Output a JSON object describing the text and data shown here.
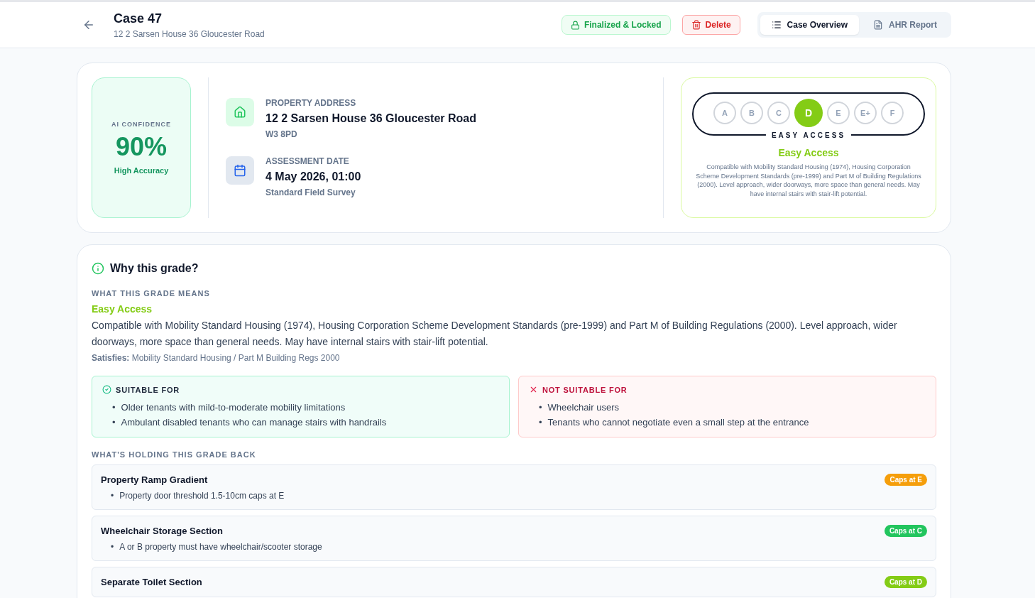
{
  "header": {
    "title": "Case 47",
    "subtitle": "12 2 Sarsen House 36 Gloucester Road",
    "status_badge": "Finalized & Locked",
    "delete_button": "Delete",
    "tabs": [
      {
        "label": "Case Overview",
        "selected": true,
        "kind": "list"
      },
      {
        "label": "AHR Report",
        "selected": false,
        "kind": "doc"
      }
    ]
  },
  "confidence": {
    "label": "AI CONFIDENCE",
    "value": "90%",
    "note": "High Accuracy"
  },
  "details": [
    {
      "kind": "home",
      "label": "PROPERTY ADDRESS",
      "value": "12 2 Sarsen House 36 Gloucester Road",
      "sub": "W3 8PD"
    },
    {
      "kind": "calendar",
      "label": "ASSESSMENT DATE",
      "value": "4 May 2026, 01:00",
      "sub": "Standard Field Survey"
    }
  ],
  "grade": {
    "scale": [
      {
        "label": "A",
        "selected": false
      },
      {
        "label": "B",
        "selected": false
      },
      {
        "label": "C",
        "selected": false
      },
      {
        "label": "D",
        "selected": true
      },
      {
        "label": "E",
        "selected": false
      },
      {
        "label": "E+",
        "selected": false
      },
      {
        "label": "F",
        "selected": false
      }
    ],
    "scale_caption": "EASY ACCESS",
    "title": "Easy Access",
    "description": "Compatible with Mobility Standard Housing (1974), Housing Corporation Scheme Development Standards (pre-1999) and Part M of Building Regulations (2000). Level approach, wider doorways, more space than general needs. May have internal stairs with stair-lift potential.",
    "color": "#84cc16"
  },
  "why": {
    "title": "Why this grade?",
    "means_heading": "WHAT THIS GRADE MEANS",
    "grade_name": "Easy Access",
    "explanation": "Compatible with Mobility Standard Housing (1974), Housing Corporation Scheme Development Standards (pre-1999) and Part M of Building Regulations (2000). Level approach, wider doorways, more space than general needs. May have internal stairs with stair-lift potential.",
    "satisfies": "**Satisfies:** Mobility Standard Housing / Part M Building Regs 2000",
    "suitability": [
      {
        "kind": "suitable",
        "heading": "SUITABLE FOR",
        "items": [
          "Older tenants with mild-to-moderate mobility limitations",
          "Ambulant disabled tenants who can manage stairs with handrails"
        ]
      },
      {
        "kind": "unsuitable",
        "heading": "NOT SUITABLE FOR",
        "items": [
          "Wheelchair users",
          "Tenants who cannot negotiate even a small step at the entrance"
        ]
      }
    ],
    "holding_heading": "WHAT'S HOLDING THIS GRADE BACK",
    "factors": [
      {
        "title": "Property Ramp Gradient",
        "badge": "Caps at E",
        "color": "#f59e0b",
        "items": [
          "Property door threshold 1.5-10cm caps at E"
        ]
      },
      {
        "title": "Wheelchair Storage Section",
        "badge": "Caps at C",
        "color": "#22c55e",
        "items": [
          "A or B property must have wheelchair/scooter storage"
        ]
      },
      {
        "title": "Separate Toilet Section",
        "badge": "Caps at D",
        "color": "#84cc16"
      }
    ],
    "bullet": "•"
  }
}
